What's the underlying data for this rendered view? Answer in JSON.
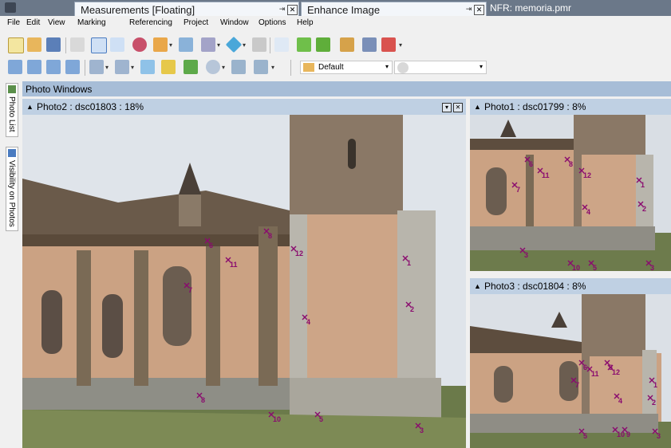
{
  "titlebar": {
    "app_title": "NFR: memoria.pmr",
    "floating": [
      {
        "label": "Measurements [Floating]"
      },
      {
        "label": "Enhance Image"
      }
    ]
  },
  "menu": [
    "File",
    "Edit",
    "View",
    "Marking",
    "Referencing",
    "Project",
    "Window",
    "Options",
    "Help"
  ],
  "toolbar": {
    "style_combo": "Default"
  },
  "left_tabs": [
    "Photo List",
    "Visibility on Photos"
  ],
  "photo_windows_label": "Photo Windows",
  "panes": [
    {
      "title": "Photo2 : dsc01803 : 18%"
    },
    {
      "title": "Photo1 : dsc01799 : 8%"
    },
    {
      "title": "Photo3 : dsc01804 : 8%"
    }
  ],
  "markers": {
    "photo2": [
      "6",
      "8",
      "12",
      "11",
      "7",
      "1",
      "4",
      "2",
      "8",
      "10",
      "5",
      "3"
    ],
    "photo1": [
      "6",
      "8",
      "12",
      "11",
      "7",
      "1",
      "2",
      "4",
      "3",
      "10",
      "5",
      "3"
    ],
    "photo3": [
      "6",
      "8",
      "12",
      "11",
      "7",
      "1",
      "4",
      "2",
      "10",
      "9",
      "5",
      "3"
    ]
  },
  "colors": {
    "titlebar": "#6b7889",
    "pane_header": "#bfd0e3",
    "marker": "#8a0a6e",
    "wall": "#c9a27e"
  }
}
